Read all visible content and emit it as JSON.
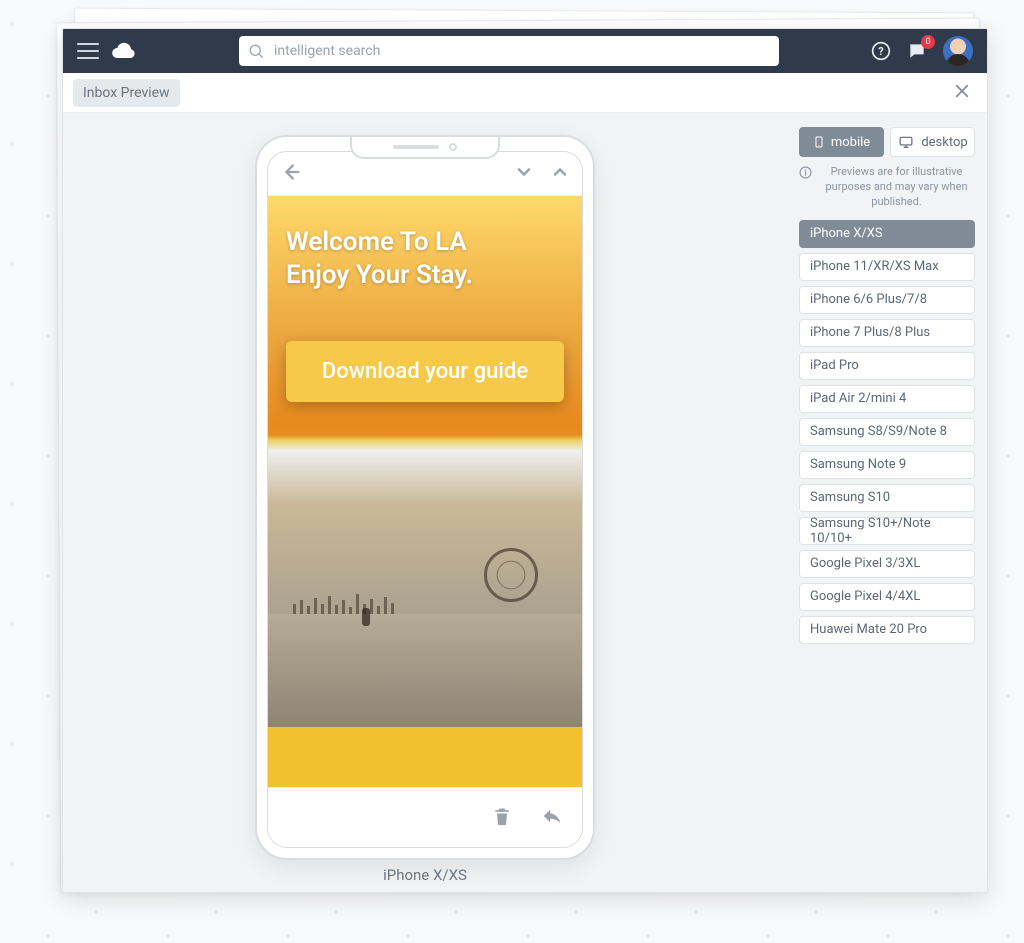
{
  "nav": {
    "search_placeholder": "intelligent search",
    "notification_count": "0"
  },
  "subbar": {
    "title": "Inbox Preview"
  },
  "preview": {
    "caption": "iPhone X/XS",
    "email": {
      "headline": "Welcome To LA\nEnjoy Your Stay.",
      "cta": "Download your guide"
    }
  },
  "side": {
    "mobile_label": "mobile",
    "desktop_label": "desktop",
    "disclaimer": "Previews are for illustrative purposes and may vary when published.",
    "devices": [
      "iPhone X/XS",
      "iPhone 11/XR/XS Max",
      "iPhone 6/6 Plus/7/8",
      "iPhone 7 Plus/8 Plus",
      "iPad Pro",
      "iPad Air 2/mini 4",
      "Samsung S8/S9/Note 8",
      "Samsung Note 9",
      "Samsung S10",
      "Samsung S10+/Note 10/10+",
      "Google Pixel 3/3XL",
      "Google Pixel 4/4XL",
      "Huawei Mate 20 Pro"
    ],
    "active_device_index": 0
  }
}
